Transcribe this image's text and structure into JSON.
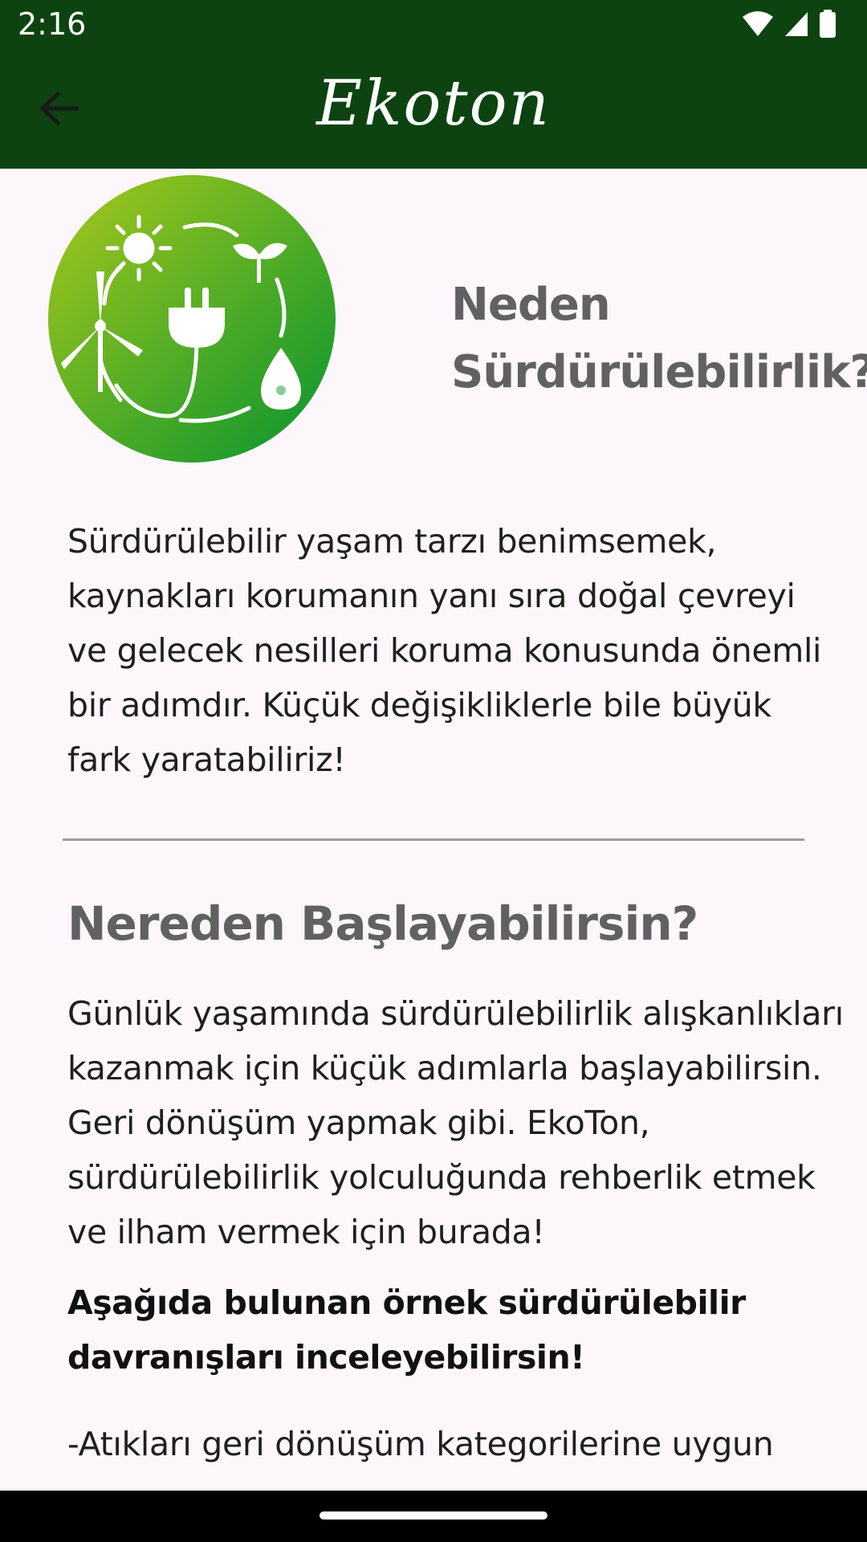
{
  "status_bar": {
    "time": "2:16",
    "icons": [
      "wifi-icon",
      "signal-icon",
      "battery-icon"
    ]
  },
  "app_bar": {
    "title": "Ekoton",
    "back_icon": "arrow-back-icon",
    "background_color": "#0c4310"
  },
  "hero": {
    "logo_icon": "sustainability-logo-icon",
    "title": "Neden Sürdürülebilirlik?"
  },
  "intro": {
    "text": "Sürdürülebilir yaşam tarzı benimsemek, kaynakları korumanın yanı sıra doğal çevreyi ve gelecek nesilleri koruma konusunda önemli bir adımdır. Küçük değişikliklerle bile büyük fark yaratabiliriz!"
  },
  "section": {
    "title": "Nereden Başlayabilirsin?",
    "text": "Günlük yaşamında sürdürülebilirlik alışkanlıkları kazanmak için küçük adımlarla başlayabilirsin. Geri dönüşüm yapmak gibi. EkoTon, sürdürülebilirlik yolculuğunda rehberlik etmek ve ilham vermek için burada!",
    "bold_text": "Aşağıda bulunan örnek sürdürülebilir davranışları inceleyebilirsin!",
    "list_first_item": "-Atıkları geri dönüşüm kategorilerine uygun"
  },
  "colors": {
    "primary_dark_green": "#0c4310",
    "logo_gradient_start": "#9bc31e",
    "logo_gradient_end": "#0a9a35",
    "heading_gray": "#616161",
    "background": "#fdf7fb"
  }
}
